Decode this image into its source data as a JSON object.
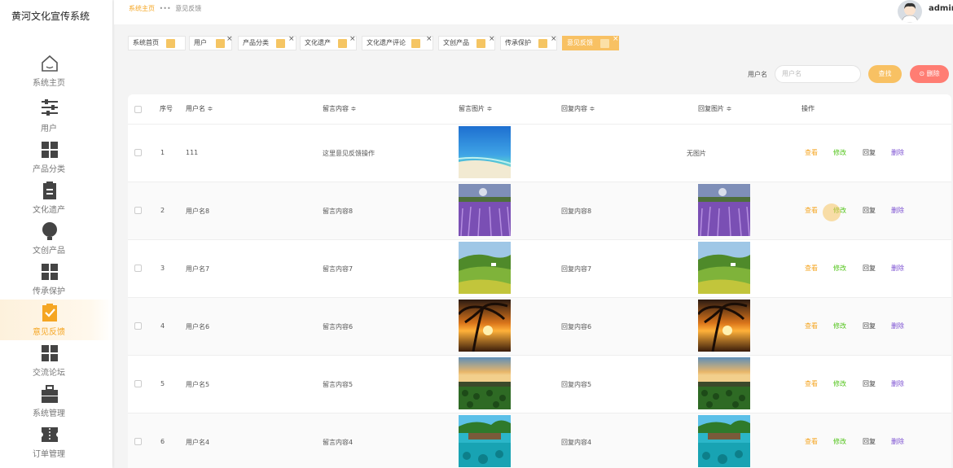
{
  "app": {
    "title": "黄河文化宣传系统"
  },
  "sidebar": {
    "items": [
      {
        "label": "系统主页",
        "icon": "home-icon"
      },
      {
        "label": "用户",
        "icon": "sliders-icon"
      },
      {
        "label": "产品分类",
        "icon": "grid-icon"
      },
      {
        "label": "文化遗产",
        "icon": "clipboard-icon"
      },
      {
        "label": "文创产品",
        "icon": "bulb-icon"
      },
      {
        "label": "传承保护",
        "icon": "grid-icon"
      },
      {
        "label": "意见反馈",
        "icon": "checklist-icon",
        "active": true
      },
      {
        "label": "交流论坛",
        "icon": "grid-icon"
      },
      {
        "label": "系统管理",
        "icon": "briefcase-icon"
      },
      {
        "label": "订单管理",
        "icon": "ticket-icon"
      }
    ]
  },
  "header": {
    "breadcrumb": {
      "home": "系统主页",
      "sep": "•••",
      "current": "意见反馈"
    },
    "user": "admin"
  },
  "tabs": [
    {
      "label": "系统首页",
      "closable": false
    },
    {
      "label": "用户",
      "closable": true
    },
    {
      "label": "产品分类",
      "closable": true
    },
    {
      "label": "文化遗产",
      "closable": true
    },
    {
      "label": "文化遗产评论",
      "closable": true
    },
    {
      "label": "文创产品",
      "closable": true
    },
    {
      "label": "传承保护",
      "closable": true
    },
    {
      "label": "意见反馈",
      "closable": true,
      "active": true
    }
  ],
  "search": {
    "label": "用户名",
    "placeholder": "用户名",
    "query_button": "查找",
    "delete_button": "⊙ 删除"
  },
  "table": {
    "headers": {
      "index": "序号",
      "username": "用户名 ≑",
      "content": "留言内容 ≑",
      "image": "留言图片 ≑",
      "reply": "回复内容 ≑",
      "reply_image": "回复图片 ≑",
      "actions": "操作"
    },
    "actions": {
      "view": "查看",
      "edit": "修改",
      "reply": "回复",
      "delete": "删除"
    },
    "rows": [
      {
        "index": "1",
        "username": "111",
        "content": "这里意见反馈操作",
        "image": "beach",
        "reply": "",
        "reply_image": null,
        "reply_image_text": "无图片"
      },
      {
        "index": "2",
        "username": "用户名8",
        "content": "留言内容8",
        "image": "lavender",
        "reply": "回复内容8",
        "reply_image": "lavender"
      },
      {
        "index": "3",
        "username": "用户名7",
        "content": "留言内容7",
        "image": "hills",
        "reply": "回复内容7",
        "reply_image": "hills"
      },
      {
        "index": "4",
        "username": "用户名6",
        "content": "留言内容6",
        "image": "palm-sunset",
        "reply": "回复内容6",
        "reply_image": "palm-sunset"
      },
      {
        "index": "5",
        "username": "用户名5",
        "content": "留言内容5",
        "image": "field-sunset",
        "reply": "回复内容5",
        "reply_image": "field-sunset"
      },
      {
        "index": "6",
        "username": "用户名4",
        "content": "留言内容4",
        "image": "tropical-sea",
        "reply": "回复内容4",
        "reply_image": "tropical-sea"
      }
    ]
  },
  "colors": {
    "accent": "#f5a623",
    "danger": "#ff7d73",
    "edit": "#52c41a",
    "delete": "#7b4fd1"
  }
}
